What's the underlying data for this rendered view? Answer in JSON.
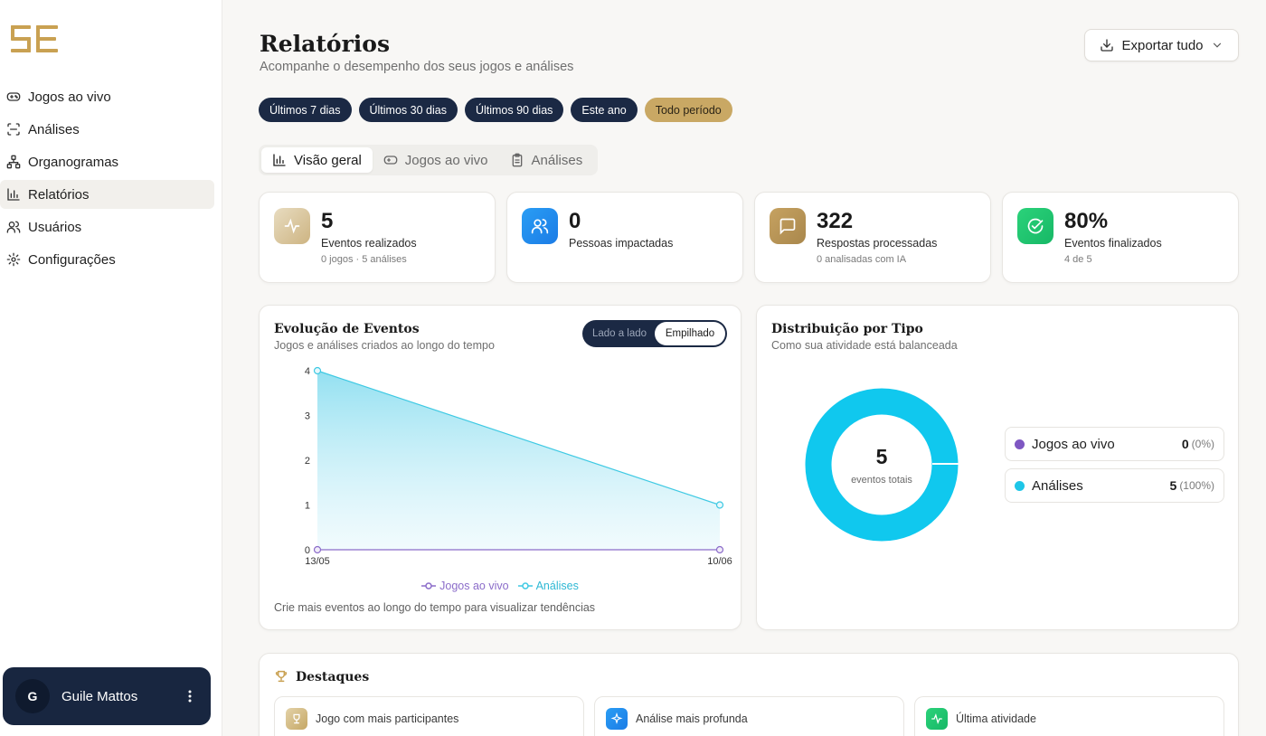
{
  "sidebar": {
    "items": [
      {
        "label": "Jogos ao vivo",
        "icon": "gamepad-icon"
      },
      {
        "label": "Análises",
        "icon": "scan-icon"
      },
      {
        "label": "Organogramas",
        "icon": "org-chart-icon"
      },
      {
        "label": "Relatórios",
        "icon": "bar-chart-icon",
        "active": true
      },
      {
        "label": "Usuários",
        "icon": "users-icon"
      },
      {
        "label": "Configurações",
        "icon": "gear-icon"
      }
    ],
    "user": {
      "initial": "G",
      "name": "Guile Mattos"
    }
  },
  "header": {
    "title": "Relatórios",
    "subtitle": "Acompanhe o desempenho dos seus jogos e análises",
    "export_label": "Exportar tudo"
  },
  "filters": [
    "Últimos 7 dias",
    "Últimos 30 dias",
    "Últimos 90 dias",
    "Este ano",
    "Todo período"
  ],
  "active_filter": "Todo período",
  "tabs": [
    "Visão geral",
    "Jogos ao vivo",
    "Análises"
  ],
  "kpis": [
    {
      "value": "5",
      "label": "Eventos realizados",
      "sub": "0 jogos · 5 análises"
    },
    {
      "value": "0",
      "label": "Pessoas impactadas",
      "sub": ""
    },
    {
      "value": "322",
      "label": "Respostas processadas",
      "sub": "0 analisadas com IA"
    },
    {
      "value": "80%",
      "label": "Eventos finalizados",
      "sub": "4 de 5"
    }
  ],
  "evolution": {
    "title": "Evolução de Eventos",
    "subtitle": "Jogos e análises criados ao longo do tempo",
    "toggle": [
      "Lado a lado",
      "Empilhado"
    ],
    "note": "Crie mais eventos ao longo do tempo para visualizar tendências"
  },
  "distribution": {
    "title": "Distribuição por Tipo",
    "subtitle": "Como sua atividade está balanceada",
    "center_value": "5",
    "center_label": "eventos totais",
    "items": [
      {
        "label": "Jogos ao vivo",
        "value": "0",
        "pct": "(0%)",
        "color": "#7e57c2"
      },
      {
        "label": "Análises",
        "value": "5",
        "pct": "(100%)",
        "color": "#1ec6e8"
      }
    ]
  },
  "highlights": {
    "title": "Destaques",
    "cards": [
      "Jogo com mais participantes",
      "Análise mais profunda",
      "Última atividade"
    ]
  },
  "chart_data": {
    "type": "area",
    "x": [
      "13/05",
      "10/06"
    ],
    "ylim": [
      0,
      4
    ],
    "yticks": [
      0,
      1,
      2,
      3,
      4
    ],
    "series": [
      {
        "name": "Jogos ao vivo",
        "values": [
          0,
          0
        ],
        "color": "#8b6cc9"
      },
      {
        "name": "Análises",
        "values": [
          4,
          1
        ],
        "color": "#3ec9e3"
      }
    ]
  }
}
